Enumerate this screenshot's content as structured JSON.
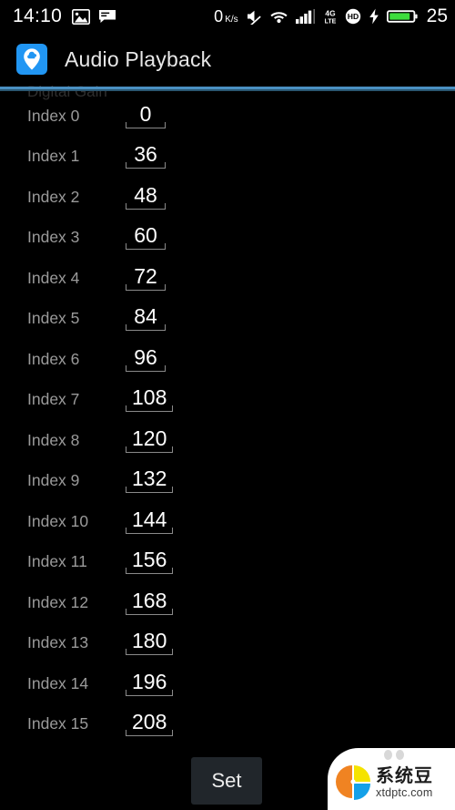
{
  "statusbar": {
    "time": "14:10",
    "left_icons": [
      {
        "name": "photo-icon"
      },
      {
        "name": "message-icon"
      }
    ],
    "network_rate": "0",
    "network_rate_unit_top": "K",
    "network_rate_unit_bottom": "s",
    "right_icons": [
      {
        "name": "mute-icon"
      },
      {
        "name": "wifi-icon"
      },
      {
        "name": "signal-bars-icon"
      },
      {
        "name": "4g-lte-icon",
        "label_top": "4G",
        "label_bottom": "LTE"
      },
      {
        "name": "hd-icon",
        "label": "HD"
      },
      {
        "name": "charging-bolt-icon"
      },
      {
        "name": "battery-icon"
      }
    ],
    "battery_percent": "25",
    "battery_color": "#3ddc3d"
  },
  "appbar": {
    "icon_name": "audio-playback-app-icon",
    "icon_bg_color": "#2196F3",
    "title": "Audio Playback"
  },
  "accent_color": "#4a90c2",
  "section": {
    "title": "Digital Gain"
  },
  "rows": [
    {
      "label": "Index 0",
      "value": "0"
    },
    {
      "label": "Index 1",
      "value": "36"
    },
    {
      "label": "Index 2",
      "value": "48"
    },
    {
      "label": "Index 3",
      "value": "60"
    },
    {
      "label": "Index 4",
      "value": "72"
    },
    {
      "label": "Index 5",
      "value": "84"
    },
    {
      "label": "Index 6",
      "value": "96"
    },
    {
      "label": "Index 7",
      "value": "108"
    },
    {
      "label": "Index 8",
      "value": "120"
    },
    {
      "label": "Index 9",
      "value": "132"
    },
    {
      "label": "Index 10",
      "value": "144"
    },
    {
      "label": "Index 11",
      "value": "156"
    },
    {
      "label": "Index 12",
      "value": "168"
    },
    {
      "label": "Index 13",
      "value": "180"
    },
    {
      "label": "Index 14",
      "value": "196"
    },
    {
      "label": "Index 15",
      "value": "208"
    }
  ],
  "footer": {
    "set_label": "Set"
  },
  "watermark": {
    "cn_text": "系统豆",
    "url_text": "xtdptc.com",
    "logo_colors": {
      "orange": "#F08322",
      "yellow": "#F5E300",
      "blue": "#14A0E8"
    }
  }
}
